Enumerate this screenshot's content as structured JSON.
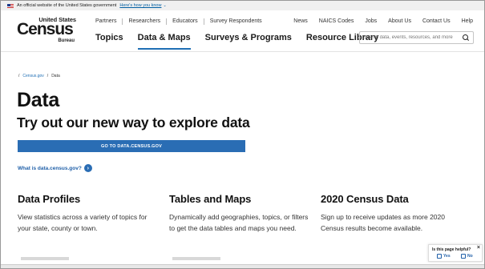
{
  "gov_banner": {
    "text": "An official website of the United States government",
    "link": "Here's how you know"
  },
  "logo": {
    "top": "United States",
    "main": "Census",
    "sub": "Bureau"
  },
  "utility_nav": [
    "Partners",
    "Researchers",
    "Educators",
    "Survey Respondents"
  ],
  "utility_right": [
    "News",
    "NAICS Codes",
    "Jobs",
    "About Us",
    "Contact Us",
    "Help"
  ],
  "main_nav": [
    {
      "label": "Topics",
      "active": false
    },
    {
      "label": "Data & Maps",
      "active": true
    },
    {
      "label": "Surveys & Programs",
      "active": false
    },
    {
      "label": "Resource Library",
      "active": false
    }
  ],
  "search": {
    "placeholder": "Search data, events, resources, and more"
  },
  "breadcrumb": {
    "home": "Census.gov",
    "separator": "/",
    "current": "Data"
  },
  "page": {
    "title": "Data",
    "subtitle": "Try out our new way to explore data",
    "cta": "GO TO DATA.CENSUS.GOV",
    "what_link": "What is data.census.gov?"
  },
  "cards": [
    {
      "title": "Data Profiles",
      "text": "View statistics across a variety of topics for your state, county or town."
    },
    {
      "title": "Tables and Maps",
      "text": "Dynamically add geographies, topics, or filters to get the data tables and maps you need."
    },
    {
      "title": "2020 Census Data",
      "text": "Sign up to receive updates as more 2020 Census results become available."
    }
  ],
  "feedback": {
    "title": "Is this page helpful?",
    "yes": "Yes",
    "no": "No",
    "close": "×"
  },
  "colors": {
    "accent": "#2a6db4",
    "link": "#1f5fa8"
  }
}
